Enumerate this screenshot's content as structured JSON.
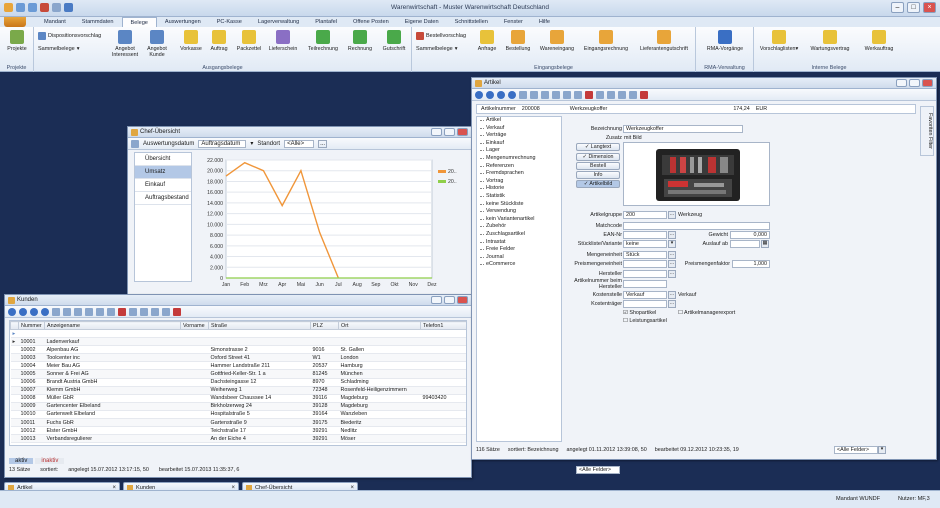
{
  "app": {
    "title": "Warenwirtschaft - Muster Warenwirtschaft Deutschland"
  },
  "menu": [
    "Mandant",
    "Stammdaten",
    "Belege",
    "Auswertungen",
    "PC-Kasse",
    "Lagerverwaltung",
    "Plantafel",
    "Offene Posten",
    "Eigene Daten",
    "Schnittstellen",
    "Fenster",
    "Hilfe"
  ],
  "ribbon": {
    "projekte": {
      "btn": "Projekte",
      "group": "Projekte"
    },
    "ausgang": {
      "small1": "Dispositionsvorschlag",
      "small2": "Sammelbelege",
      "b1": "Angebot Interessent",
      "b2": "Angebot Kunde",
      "b3": "Vorkasse",
      "b4": "Auftrag",
      "b5": "Packzettel",
      "b6": "Lieferschein",
      "b7": "Teilrechnung",
      "b8": "Rechnung",
      "b9": "Gutschrift",
      "group": "Ausgangsbelege"
    },
    "eingang": {
      "small1": "Bestellvorschlag",
      "small2": "Sammelbelege",
      "b1": "Anfrage",
      "b2": "Bestellung",
      "b3": "Wareneingang",
      "b4": "Eingangsrechnung",
      "b5": "Lieferantengutschrift",
      "group": "Eingangsbelege"
    },
    "rma": {
      "b1": "RMA-Vorgänge",
      "group": "RMA-Verwaltung"
    },
    "intern": {
      "b1": "Vorschlaglisten",
      "b2": "Wartungsvertrag",
      "b3": "Werkauftrag",
      "group": "Interne Belege"
    }
  },
  "chef": {
    "title": "Chef-Übersicht",
    "nav": [
      "Übersicht",
      "Umsatz",
      "Einkauf",
      "Auftragsbestand"
    ],
    "auswertung_label": "Auswertungsdatum",
    "auswertung_value": "Auftragsdatum",
    "standort_label": "Standort",
    "standort_value": "<Alle>"
  },
  "chart_data": {
    "type": "line",
    "categories": [
      "Jan",
      "Feb",
      "Mrz",
      "Apr",
      "Mai",
      "Jun",
      "Jul",
      "Aug",
      "Sep",
      "Okt",
      "Nov",
      "Dez"
    ],
    "ylim": [
      0,
      22000
    ],
    "yticks": [
      "0",
      "2.000",
      "4.000",
      "6.000",
      "8.000",
      "10.000",
      "12.000",
      "14.000",
      "16.000",
      "18.000",
      "20.000",
      "22.000"
    ],
    "series": [
      {
        "name": "20..",
        "color": "#f0963a",
        "values": [
          19000,
          21500,
          20000,
          13500,
          20000,
          8500,
          0,
          null,
          null,
          null,
          null,
          null
        ]
      },
      {
        "name": "20..",
        "color": "#8fcf4a",
        "values": [
          0,
          0,
          0,
          0,
          0,
          0,
          0,
          0,
          0,
          0,
          0,
          0
        ]
      }
    ]
  },
  "kunden": {
    "title": "Kunden",
    "columns": [
      "Nummer",
      "Anzeigename",
      "Vorname",
      "Straße",
      "PLZ",
      "Ort",
      "Telefon1"
    ],
    "rows": [
      [
        "10001",
        "Ladenverkauf",
        "",
        "",
        "",
        "",
        ""
      ],
      [
        "10002",
        "Alpenbau AG",
        "",
        "Simonstrasse 2",
        "9016",
        "St. Gallen",
        ""
      ],
      [
        "10003",
        "Toolcenter inc",
        "",
        "Oxford Street 41",
        "W1",
        "London",
        ""
      ],
      [
        "10004",
        "Meier Bau AG",
        "",
        "Hammer Landstraße 211",
        "20537",
        "Hamburg",
        ""
      ],
      [
        "10005",
        "Sonner & Frei AG",
        "",
        "Gottfried-Keller-Str. 1 a",
        "81245",
        "München",
        ""
      ],
      [
        "10006",
        "Brandt Austria GmbH",
        "",
        "Dachsteingasse 12",
        "8970",
        "Schladming",
        ""
      ],
      [
        "10007",
        "Klemm GmbH",
        "",
        "Weiherweg 1",
        "72348",
        "Rosenfeld-Heiligenzimmern",
        ""
      ],
      [
        "10008",
        "Müller GbR",
        "",
        "Wandsbeer Chaussee 14",
        "39116",
        "Magdeburg",
        "99403420"
      ],
      [
        "10009",
        "Gartencenter Elbeland",
        "",
        "Birkholzerweg 24",
        "39128",
        "Magdeburg",
        ""
      ],
      [
        "10010",
        "Gartenwelt Elbeland",
        "",
        "Hospitalstraße 5",
        "39164",
        "Wanzleben",
        ""
      ],
      [
        "10011",
        "Fuchs GbR",
        "",
        "Gartenstraße 9",
        "39175",
        "Biederitz",
        ""
      ],
      [
        "10012",
        "Elster GmbH",
        "",
        "Teichstraße 17",
        "39291",
        "Nedlitz",
        ""
      ],
      [
        "10013",
        "Verbandsregulierer",
        "",
        "An der Eiche 4",
        "39291",
        "Möser",
        ""
      ]
    ],
    "tab_active": "aktiv",
    "tab_inactive": "inaktiv",
    "status": {
      "count": "13 Sätze",
      "sorted": "sortiert:",
      "created": "angelegt 15.07.2012 13:17:15, 50",
      "edited": "bearbeitet 15.07.2013 11:35:37, 6"
    }
  },
  "artikel": {
    "title": "Artikel",
    "nr_label": "Artikelnummer",
    "nr": "200008",
    "name": "Werkzeugkoffer",
    "price": "174,24",
    "currency": "EUR",
    "tree": [
      "Artikel",
      "Verkauf",
      "Verträge",
      "Einkauf",
      "Lager",
      "Mengenumrechnung",
      "Referenzen",
      "Fremdsprachen",
      "Vortrag",
      "Historie",
      "Statistik",
      "keine Stückliste",
      "Verwendung",
      "kein Variantenartikel",
      "Zubehör",
      "Zuschlagsartikel",
      "Intrastat",
      "Freie Felder",
      "Journal",
      "eCommerce"
    ],
    "bez_label": "Bezeichnung",
    "bez": "Werkzeugkoffer",
    "zusatz_label": "Zusatz",
    "zusatz": "mit Bild",
    "side": [
      "Langtext",
      "Dimension",
      "Bestell",
      "Info",
      "Artikelbild"
    ],
    "gruppe_label": "Artikelgruppe",
    "gruppe": "200",
    "gruppe_name": "Werkzeug",
    "match_label": "Matchcode",
    "ean_label": "EAN-Nr",
    "gewicht_label": "Gewicht",
    "gewicht": "0,000",
    "stueck_label": "Stückliste/Variante",
    "stueck": "keine",
    "auslauf_label": "Auslauf ab",
    "menge_label": "Mengeneinheit",
    "menge": "Stück",
    "preis_label": "Preismengeneinheit",
    "pfaktor_label": "Preismengenfaktor",
    "pfaktor": "1,000",
    "herst_label": "Hersteller",
    "hnr_label": "Artikelnummer beim Hersteller",
    "kst_label": "Kostenstelle",
    "kst": "Verkauf",
    "kst_name": "Verkauf",
    "ktr_label": "Kostenträger",
    "cb1": "Shopartikel",
    "cb2": "Artikelmanagerexport",
    "cb3": "Leistungsartikel",
    "filter": "<Alle Felder>",
    "status": {
      "count": "116 Sätze",
      "sorted": "sortiert: Bezeichnung",
      "created": "angelegt 01.11.2012 13:39:08, 50",
      "edited": "bearbeitet 09.12.2012 10:23:35, 19"
    },
    "favtab": "Favoriten Filter"
  },
  "tasks": [
    "Artikel",
    "Kunden",
    "Chef-Übersicht"
  ],
  "statusbar": {
    "mandant": "Mandant WUNDF",
    "nutzer": "Nutzer: MF,3"
  }
}
